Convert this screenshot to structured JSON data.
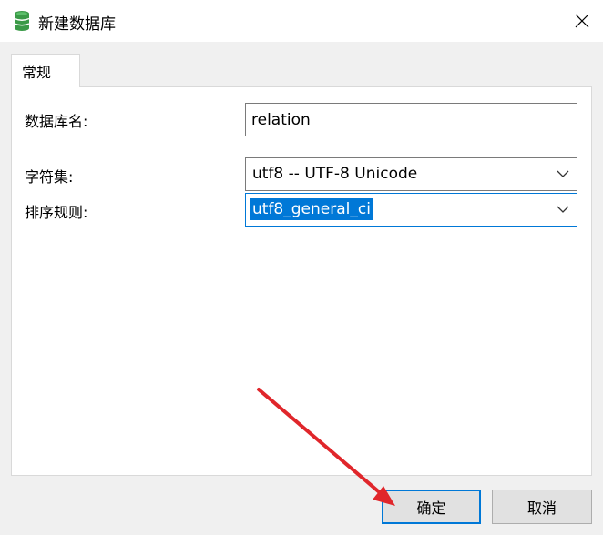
{
  "window": {
    "title": "新建数据库",
    "icon": "database-icon",
    "close_icon": "close-icon"
  },
  "tabs": [
    {
      "label": "常规",
      "active": true
    }
  ],
  "form": {
    "db_name_label": "数据库名:",
    "db_name_value": "relation",
    "charset_label": "字符集:",
    "charset_value": "utf8 -- UTF-8 Unicode",
    "collation_label": "排序规则:",
    "collation_value": "utf8_general_ci"
  },
  "buttons": {
    "ok_label": "确定",
    "cancel_label": "取消"
  },
  "annotation": {
    "type": "red-arrow",
    "color": "#e0262b"
  },
  "colors": {
    "accent": "#0078d7",
    "db_icon": "#3a9a47"
  }
}
